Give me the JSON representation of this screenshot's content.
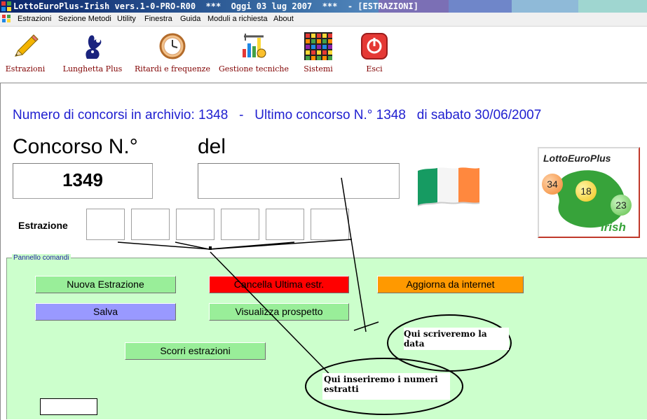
{
  "window": {
    "title": "LottoEuroPlus-Irish vers.1-0-PRO-R00  ***  Oggi 03 lug 2007  ***  - [ESTRAZIONI]",
    "title_colors": [
      "#0a246a",
      "#3a6ea5",
      "#a6caf0"
    ]
  },
  "menu": {
    "items": [
      "Estrazioni",
      "Sezione Metodi",
      "Utility",
      "Finestra",
      "Guida",
      "Moduli a richiesta",
      "About"
    ]
  },
  "toolbar": {
    "items": [
      {
        "label": "Estrazioni",
        "icon": "pencil-icon"
      },
      {
        "label": "Lunghetta Plus",
        "icon": "lottery-hand-icon"
      },
      {
        "label": "Ritardi e frequenze",
        "icon": "clock-icon"
      },
      {
        "label": "Gestione tecniche",
        "icon": "tools-chart-icon"
      },
      {
        "label": "Sistemi",
        "icon": "grid-icon"
      },
      {
        "label": "Esci",
        "icon": "power-icon"
      }
    ],
    "label_color": "#800000"
  },
  "main": {
    "info_line": "Numero di concorsi in archivio: 1348   -   Ultimo concorso N.° 1348   di sabato 30/06/2007",
    "concorso_label": "Concorso N.°",
    "del_label": "del",
    "concorso_value": "1349",
    "date_value": "",
    "estrazione_label": "Estrazione",
    "numbers": [
      "",
      "",
      "",
      "",
      "",
      ""
    ],
    "info_color": "#1f1fd0"
  },
  "logo": {
    "title": "LottoEuroPlus",
    "subtitle": "Irish",
    "balls": [
      "34",
      "18",
      "23"
    ]
  },
  "flag": {
    "icon": "irish-flag-icon",
    "colors": [
      "#169b62",
      "#ffffff",
      "#ff883e"
    ]
  },
  "panel": {
    "title": "Pannello comandi",
    "background": "#ccffcc",
    "buttons": {
      "nuova": {
        "label": "Nuova Estrazione",
        "color": "#99ee99"
      },
      "cancella": {
        "label": "Cancella Ultima estr.",
        "color": "#ff0000"
      },
      "aggiorna": {
        "label": "Aggiorna da internet",
        "color": "#ff9900"
      },
      "salva": {
        "label": "Salva",
        "color": "#9999ff"
      },
      "visualizza": {
        "label": "Visualizza prospetto",
        "color": "#99ee99"
      },
      "scorri": {
        "label": "Scorri estrazioni",
        "color": "#99ee99"
      }
    },
    "small_field_value": ""
  },
  "annotations": {
    "date_note": "Qui scriveremo la data",
    "numbers_note": "Qui inseriremo i numeri estratti"
  }
}
